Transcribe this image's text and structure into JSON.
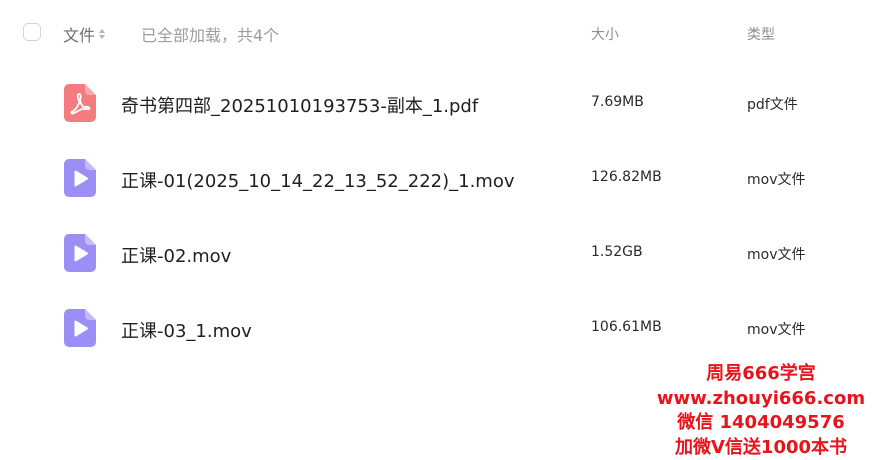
{
  "header": {
    "name_label": "文件",
    "status_text": "已全部加载，共4个",
    "size_label": "大小",
    "type_label": "类型"
  },
  "files": [
    {
      "name": "奇书第四部_20251010193753-副本_1.pdf",
      "size": "7.69MB",
      "type": "pdf文件",
      "icon": "pdf-file-icon"
    },
    {
      "name": "正课-01(2025_10_14_22_13_52_222)_1.mov",
      "size": "126.82MB",
      "type": "mov文件",
      "icon": "video-file-icon"
    },
    {
      "name": "正课-02.mov",
      "size": "1.52GB",
      "type": "mov文件",
      "icon": "video-file-icon"
    },
    {
      "name": "正课-03_1.mov",
      "size": "106.61MB",
      "type": "mov文件",
      "icon": "video-file-icon"
    }
  ],
  "watermark": {
    "line1": "周易666学宫",
    "line2": "www.zhouyi666.com",
    "line3": "微信 1404049576",
    "line4": "加微V信送1000本书"
  },
  "colors": {
    "pdf_icon": "#f27c7f",
    "video_icon": "#9b8ff5",
    "watermark": "#e8141c"
  }
}
